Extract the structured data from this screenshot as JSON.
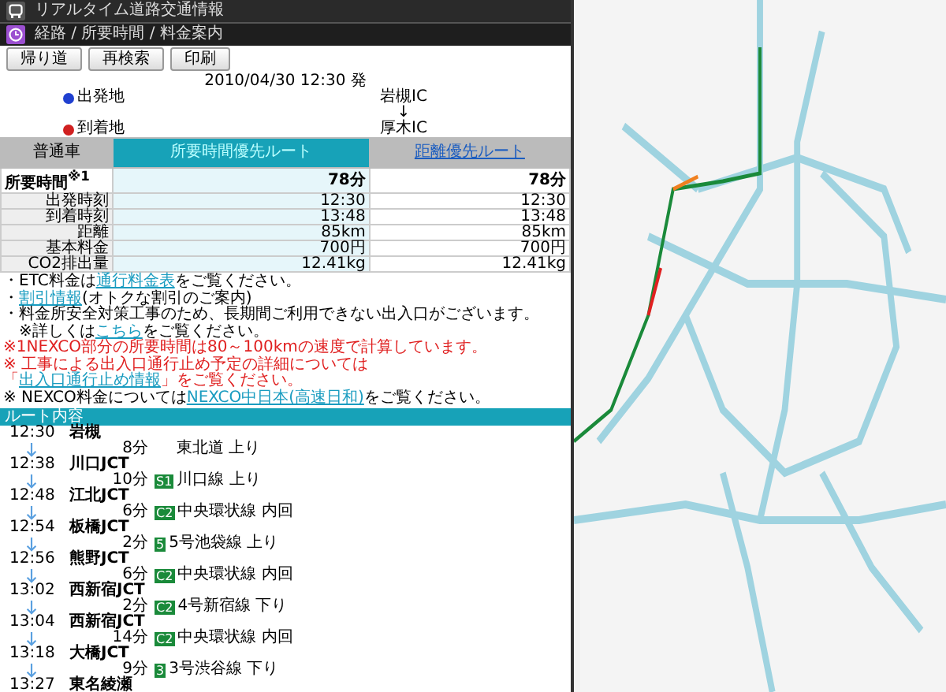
{
  "app_title": "リアルタイム道路交通情報",
  "section_title": "経路 / 所要時間 / 料金案内",
  "buttons": [
    "帰り道",
    "再検索",
    "印刷"
  ],
  "departure_time": "2010/04/30 12:30 発",
  "origin": {
    "label": "出発地",
    "value": "岩槻IC"
  },
  "arrow": "↓",
  "destination": {
    "label": "到着地",
    "value": "厚木IC"
  },
  "table": {
    "corner": "普通車",
    "routes": [
      {
        "label": "所要時間優先ルート",
        "selected": true
      },
      {
        "label": "距離優先ルート",
        "selected": false
      }
    ],
    "rows": [
      {
        "label": "所要時間$^{※1}$",
        "values": [
          "78分",
          "78分"
        ],
        "kind": "main"
      },
      {
        "label": "出発時刻",
        "values": [
          "12:30",
          "12:30"
        ],
        "kind": "sub"
      },
      {
        "label": "到着時刻",
        "values": [
          "13:48",
          "13:48"
        ],
        "kind": "sub"
      },
      {
        "label": "距離",
        "values": [
          "85km",
          "85km"
        ],
        "kind": "sub"
      },
      {
        "label": "基本料金",
        "values": [
          "700円",
          "700円"
        ],
        "kind": "sub"
      },
      {
        "label": "CO2排出量",
        "values": [
          "12.41kg",
          "12.41kg"
        ],
        "kind": "sub"
      }
    ]
  },
  "notes": [
    {
      "before": "・ETC料金は",
      "link": "通行料金表",
      "after": "をご覧ください。",
      "kind": "plain"
    },
    {
      "before": "・",
      "link": "割引情報",
      "after": "(オトクな割引のご案内)",
      "kind": "plain"
    },
    {
      "before": "・料金所安全対策工事のため、長期間ご利用できない出入口がございます。",
      "kind": "plain"
    },
    {
      "before": "　※詳しくは",
      "link": "こちら",
      "after": "をご覧ください。",
      "kind": "plain"
    },
    {
      "before": "※1NEXCO部分の所要時間は80～100kmの速度で計算しています。",
      "kind": "alert"
    },
    {
      "before": "※ 工事による出入口通行止め予定の詳細については",
      "kind": "alert"
    },
    {
      "before": "「",
      "link": "出入口通行止め情報",
      "after": "」をご覧ください。",
      "kind": "alert"
    },
    {
      "before": "※ NEXCO料金については",
      "link": "NEXCO中日本(高速日和)",
      "after": "をご覧ください。",
      "kind": "plain"
    }
  ],
  "route_heading": "ルート内容",
  "route": [
    {
      "kind": "stop",
      "time": "12:30",
      "name": "岩槻"
    },
    {
      "kind": "leg",
      "duration": "8分",
      "road": "東北道 上り"
    },
    {
      "kind": "stop",
      "time": "12:38",
      "name": "川口JCT"
    },
    {
      "kind": "leg",
      "duration": "10分",
      "badge": "S1",
      "road": "川口線 上り"
    },
    {
      "kind": "stop",
      "time": "12:48",
      "name": "江北JCT"
    },
    {
      "kind": "leg",
      "duration": "6分",
      "badge": "C2",
      "road": "中央環状線 内回"
    },
    {
      "kind": "stop",
      "time": "12:54",
      "name": "板橋JCT"
    },
    {
      "kind": "leg",
      "duration": "2分",
      "badge": "5",
      "road": "5号池袋線 上り"
    },
    {
      "kind": "stop",
      "time": "12:56",
      "name": "熊野JCT"
    },
    {
      "kind": "leg",
      "duration": "6分",
      "badge": "C2",
      "road": "中央環状線 内回"
    },
    {
      "kind": "stop",
      "time": "13:02",
      "name": "西新宿JCT"
    },
    {
      "kind": "leg",
      "duration": "2分",
      "badge": "C2",
      "road": "4号新宿線 下り"
    },
    {
      "kind": "stop",
      "time": "13:04",
      "name": "西新宿JCT"
    },
    {
      "kind": "leg",
      "duration": "14分",
      "badge": "C2",
      "road": "中央環状線 内回"
    },
    {
      "kind": "stop",
      "time": "13:18",
      "name": "大橋JCT"
    },
    {
      "kind": "leg",
      "duration": "9分",
      "badge": "3",
      "road": "3号渋谷線 下り"
    },
    {
      "kind": "stop",
      "time": "13:27",
      "name": "東名綾瀬"
    }
  ]
}
